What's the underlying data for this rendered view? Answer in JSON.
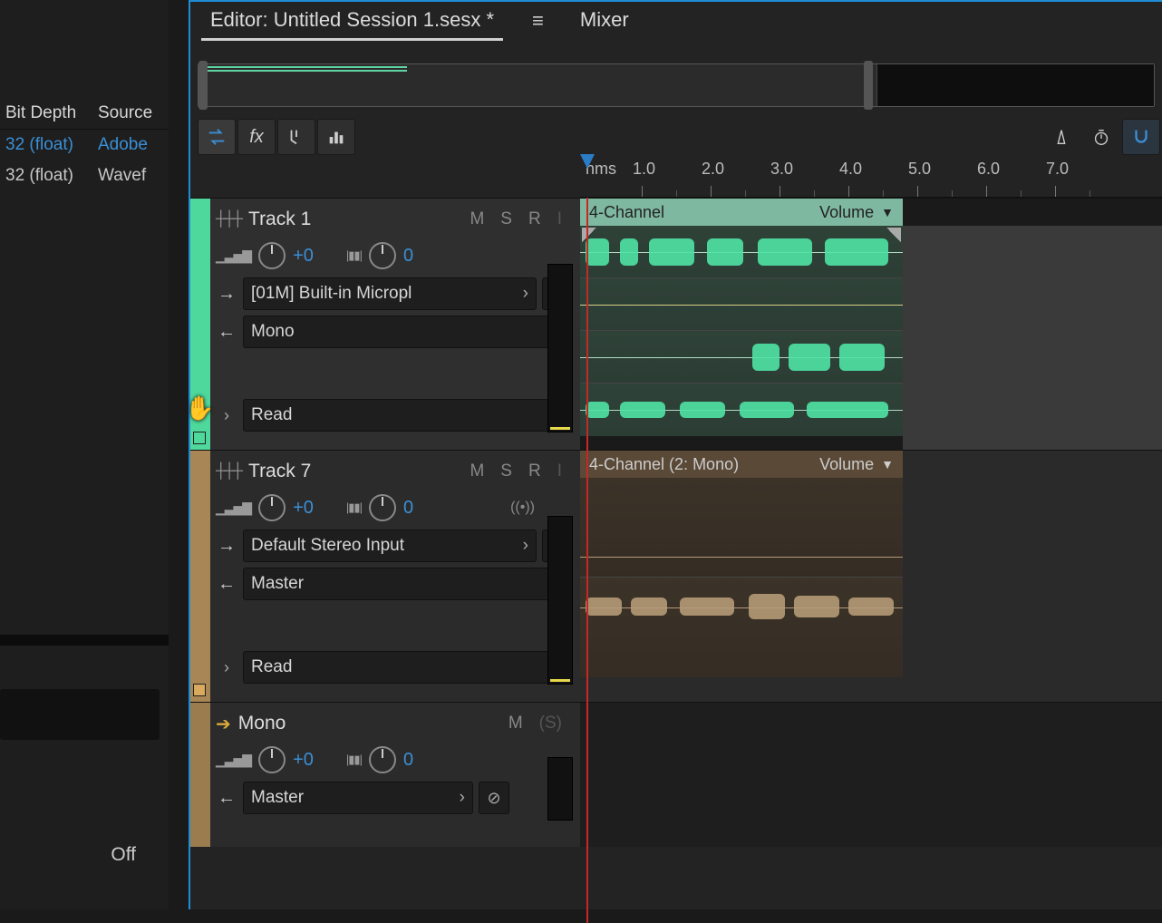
{
  "left_panel": {
    "columns": {
      "bit_depth": "Bit Depth",
      "source": "Source"
    },
    "rows": [
      {
        "bit_depth": "32 (float)",
        "source": "Adobe"
      },
      {
        "bit_depth": "32 (float)",
        "source": "Wavef"
      }
    ],
    "off_label": "Off"
  },
  "tabs": {
    "editor": "Editor: Untitled Session 1.sesx *",
    "mixer": "Mixer"
  },
  "ruler": {
    "unit": "hms",
    "marks": [
      "1.0",
      "2.0",
      "3.0",
      "4.0",
      "5.0",
      "6.0",
      "7.0"
    ]
  },
  "tracks": [
    {
      "id": "track1",
      "name": "Track 1",
      "color": "#4fd89b",
      "buttons": {
        "m": "M",
        "s": "S",
        "r": "R",
        "i": "I"
      },
      "volume": "+0",
      "pan": "0",
      "input": "[01M] Built-in Micropl",
      "output": "Mono",
      "automation": "Read",
      "clip": {
        "name": "4-Channel",
        "param": "Volume"
      }
    },
    {
      "id": "track7",
      "name": "Track 7",
      "color": "#a88656",
      "buttons": {
        "m": "M",
        "s": "S",
        "r": "R",
        "i": "I"
      },
      "volume": "+0",
      "pan": "0",
      "input": "Default Stereo Input",
      "output": "Master",
      "automation": "Read",
      "monitor_icon": "((•))",
      "clip": {
        "name": "4-Channel (2: Mono)",
        "param": "Volume"
      }
    },
    {
      "id": "mono-bus",
      "name": "Mono",
      "color": "#9a7c4e",
      "buttons": {
        "m": "M",
        "s": "(S)"
      },
      "volume": "+0",
      "pan": "0",
      "output": "Master"
    }
  ]
}
